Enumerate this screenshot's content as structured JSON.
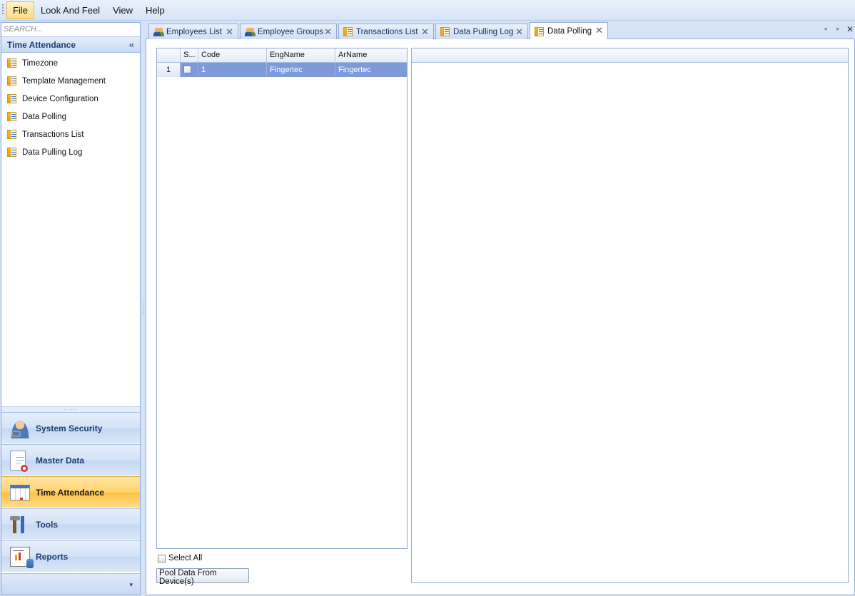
{
  "menubar": {
    "items": [
      {
        "label": "File",
        "active": true
      },
      {
        "label": "Look And Feel",
        "active": false
      },
      {
        "label": "View",
        "active": false
      },
      {
        "label": "Help",
        "active": false
      }
    ]
  },
  "sidebar": {
    "search_placeholder": "SEARCH...",
    "header": "Time Attendance",
    "collapse_glyph": "«",
    "items": [
      {
        "label": "Timezone",
        "icon": "list-icon"
      },
      {
        "label": "Template Management",
        "icon": "list-icon"
      },
      {
        "label": "Device Configuration",
        "icon": "list-icon"
      },
      {
        "label": "Data Polling",
        "icon": "list-icon"
      },
      {
        "label": "Transactions List",
        "icon": "list-icon"
      },
      {
        "label": "Data Pulling Log",
        "icon": "list-icon"
      }
    ],
    "splitter_glyph": "......",
    "groups": [
      {
        "label": "System Security",
        "icon": "user-key-icon",
        "active": false
      },
      {
        "label": "Master Data",
        "icon": "document-icon",
        "active": false
      },
      {
        "label": "Time Attendance",
        "icon": "calendar-icon",
        "active": true
      },
      {
        "label": "Tools",
        "icon": "tools-icon",
        "active": false
      },
      {
        "label": "Reports",
        "icon": "report-icon",
        "active": false
      }
    ],
    "overflow_glyph": "▾"
  },
  "tabs": [
    {
      "label": "Employees List",
      "icon": "people-icon",
      "active": false
    },
    {
      "label": "Employee Groups",
      "icon": "people-icon",
      "active": false
    },
    {
      "label": "Transactions List",
      "icon": "list-icon",
      "active": false
    },
    {
      "label": "Data Pulling Log",
      "icon": "list-icon",
      "active": false
    },
    {
      "label": "Data Polling",
      "icon": "list-icon",
      "active": true
    }
  ],
  "tab_controls": {
    "prev": "◂",
    "next": "▸",
    "close": "✕",
    "tab_close": "✕"
  },
  "grid": {
    "columns": [
      "",
      "S...",
      "Code",
      "EngName",
      "ArName"
    ],
    "rows": [
      {
        "num": "1",
        "selected_check": false,
        "code": "1",
        "eng_name": "Fingertec",
        "ar_name": "Fingertec"
      }
    ]
  },
  "select_all_label": "Select All",
  "pool_button_label": "Pool Data From Device(s)",
  "colors": {
    "accent": "#8eaad4",
    "selection": "#7e9ad8",
    "active_group": "#ffc13f"
  }
}
